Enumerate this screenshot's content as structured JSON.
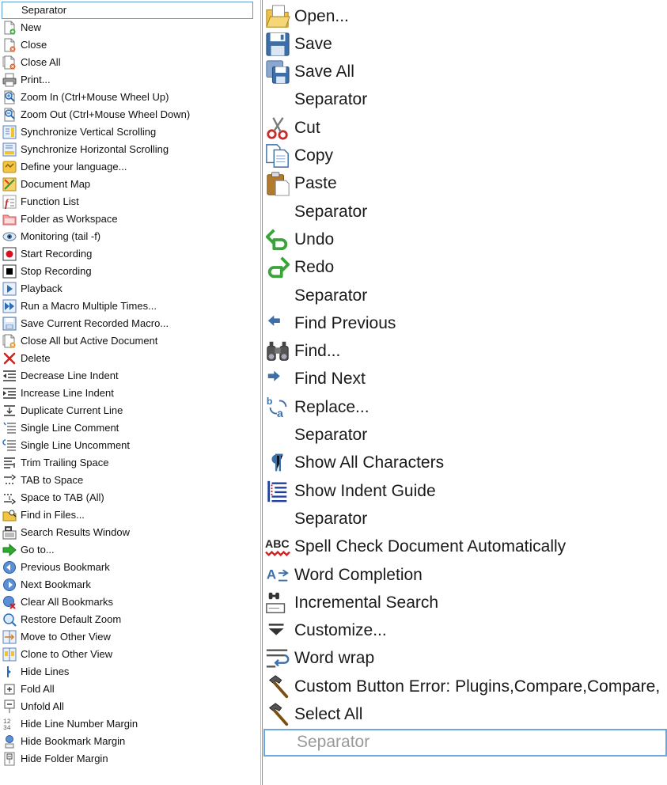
{
  "left_items": [
    {
      "label": "Separator",
      "icon": "none"
    },
    {
      "label": "New",
      "icon": "new-file-icon"
    },
    {
      "label": "Close",
      "icon": "close-file-icon"
    },
    {
      "label": "Close All",
      "icon": "close-all-icon"
    },
    {
      "label": "Print...",
      "icon": "print-icon"
    },
    {
      "label": "Zoom In (Ctrl+Mouse Wheel Up)",
      "icon": "zoom-in-icon"
    },
    {
      "label": "Zoom Out (Ctrl+Mouse Wheel Down)",
      "icon": "zoom-out-icon"
    },
    {
      "label": "Synchronize Vertical Scrolling",
      "icon": "sync-vertical-icon"
    },
    {
      "label": "Synchronize Horizontal Scrolling",
      "icon": "sync-horizontal-icon"
    },
    {
      "label": "Define your language...",
      "icon": "define-language-icon"
    },
    {
      "label": "Document Map",
      "icon": "document-map-icon"
    },
    {
      "label": "Function List",
      "icon": "function-list-icon"
    },
    {
      "label": "Folder as Workspace",
      "icon": "folder-workspace-icon"
    },
    {
      "label": "Monitoring (tail -f)",
      "icon": "eye-icon"
    },
    {
      "label": "Start Recording",
      "icon": "record-icon"
    },
    {
      "label": "Stop Recording",
      "icon": "stop-icon"
    },
    {
      "label": "Playback",
      "icon": "play-icon"
    },
    {
      "label": "Run a Macro Multiple Times...",
      "icon": "fast-forward-icon"
    },
    {
      "label": "Save Current Recorded Macro...",
      "icon": "save-macro-icon"
    },
    {
      "label": "Close All but Active Document",
      "icon": "close-but-active-icon"
    },
    {
      "label": "Delete",
      "icon": "delete-x-icon"
    },
    {
      "label": "Decrease Line Indent",
      "icon": "decrease-indent-icon"
    },
    {
      "label": "Increase Line Indent",
      "icon": "increase-indent-icon"
    },
    {
      "label": "Duplicate Current Line",
      "icon": "duplicate-line-icon"
    },
    {
      "label": "Single Line Comment",
      "icon": "comment-icon"
    },
    {
      "label": "Single Line Uncomment",
      "icon": "uncomment-icon"
    },
    {
      "label": "Trim Trailing Space",
      "icon": "trim-space-icon"
    },
    {
      "label": "TAB to Space",
      "icon": "tab-to-space-icon"
    },
    {
      "label": "Space to TAB (All)",
      "icon": "space-to-tab-icon"
    },
    {
      "label": "Find in Files...",
      "icon": "find-in-files-icon"
    },
    {
      "label": "Search Results Window",
      "icon": "search-results-icon"
    },
    {
      "label": "Go to...",
      "icon": "goto-arrow-icon"
    },
    {
      "label": "Previous Bookmark",
      "icon": "previous-bookmark-icon"
    },
    {
      "label": "Next Bookmark",
      "icon": "next-bookmark-icon"
    },
    {
      "label": "Clear All Bookmarks",
      "icon": "clear-bookmarks-icon"
    },
    {
      "label": "Restore Default Zoom",
      "icon": "restore-zoom-icon"
    },
    {
      "label": "Move to Other View",
      "icon": "move-view-icon"
    },
    {
      "label": "Clone to Other View",
      "icon": "clone-view-icon"
    },
    {
      "label": "Hide Lines",
      "icon": "hide-lines-icon"
    },
    {
      "label": "Fold All",
      "icon": "fold-all-icon"
    },
    {
      "label": "Unfold All",
      "icon": "unfold-all-icon"
    },
    {
      "label": "Hide Line Number Margin",
      "icon": "line-number-margin-icon"
    },
    {
      "label": "Hide Bookmark Margin",
      "icon": "bookmark-margin-icon"
    },
    {
      "label": "Hide Folder Margin",
      "icon": "folder-margin-icon"
    }
  ],
  "right_items": [
    {
      "label": "Open...",
      "icon": "open-folder-icon"
    },
    {
      "label": "Save",
      "icon": "save-disk-icon"
    },
    {
      "label": "Save All",
      "icon": "save-all-icon"
    },
    {
      "label": "Separator",
      "icon": "none"
    },
    {
      "label": "Cut",
      "icon": "scissors-icon"
    },
    {
      "label": "Copy",
      "icon": "copy-icon"
    },
    {
      "label": "Paste",
      "icon": "paste-icon"
    },
    {
      "label": "Separator",
      "icon": "none"
    },
    {
      "label": "Undo",
      "icon": "undo-icon"
    },
    {
      "label": "Redo",
      "icon": "redo-icon"
    },
    {
      "label": "Separator",
      "icon": "none"
    },
    {
      "label": "Find Previous",
      "icon": "find-previous-icon"
    },
    {
      "label": "Find...",
      "icon": "binoculars-icon"
    },
    {
      "label": "Find Next",
      "icon": "find-next-icon"
    },
    {
      "label": "Replace...",
      "icon": "replace-icon"
    },
    {
      "label": "Separator",
      "icon": "none"
    },
    {
      "label": "Show All Characters",
      "icon": "pilcrow-icon"
    },
    {
      "label": "Show Indent Guide",
      "icon": "indent-guide-icon"
    },
    {
      "label": "Separator",
      "icon": "none"
    },
    {
      "label": "Spell Check Document Automatically",
      "icon": "spell-check-icon"
    },
    {
      "label": "Word Completion",
      "icon": "word-completion-icon"
    },
    {
      "label": "Incremental Search",
      "icon": "incremental-search-icon"
    },
    {
      "label": "Customize...",
      "icon": "customize-icon"
    },
    {
      "label": "Word wrap",
      "icon": "word-wrap-icon"
    },
    {
      "label": "Custom Button Error: Plugins,Compare,Compare,",
      "icon": "hammer-icon"
    },
    {
      "label": "Select All",
      "icon": "hammer-icon"
    },
    {
      "label": "Separator",
      "icon": "none"
    }
  ],
  "left_selected_index": 0,
  "right_selected_index": 26,
  "colors": {
    "selection_border": "#5b9bd5",
    "panel_divider": "#b9b9b9",
    "disabled_text": "#9a9a9a"
  }
}
